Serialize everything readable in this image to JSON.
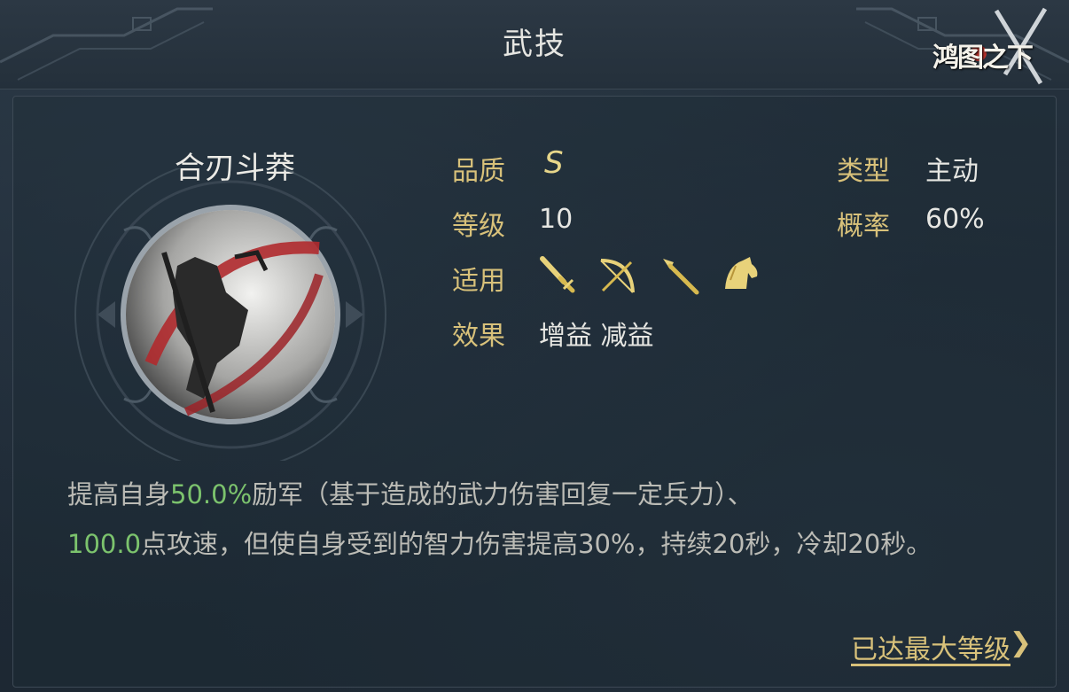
{
  "header": {
    "title": "武技",
    "logo_text": "鸿图之下"
  },
  "skill": {
    "name": "合刃斗莽"
  },
  "attributes": {
    "quality_label": "品质",
    "quality_value": "S",
    "level_label": "等级",
    "level_value": "10",
    "applies_label": "适用",
    "applies_icons": [
      "sword-icon",
      "bow-icon",
      "spear-icon",
      "horse-icon"
    ],
    "effect_label": "效果",
    "effect_value": "增益 减益",
    "type_label": "类型",
    "type_value": "主动",
    "chance_label": "概率",
    "chance_value": "60%"
  },
  "description": {
    "part1": "提高自身",
    "highlight1": "50.0%",
    "part2": "励军（基于造成的武力伤害回复一定兵力）、",
    "highlight2": "100.0",
    "part3": "点攻速，但使自身受到的智力伤害提高30%，持续20秒，冷却20秒。"
  },
  "footer": {
    "max_level_label": "已达最大等级",
    "chevron": "❯"
  },
  "colors": {
    "label_gold": "#d8c17a",
    "highlight_green": "#7cc36d",
    "text_light": "#e6e6e2",
    "background": "#1c2833"
  }
}
